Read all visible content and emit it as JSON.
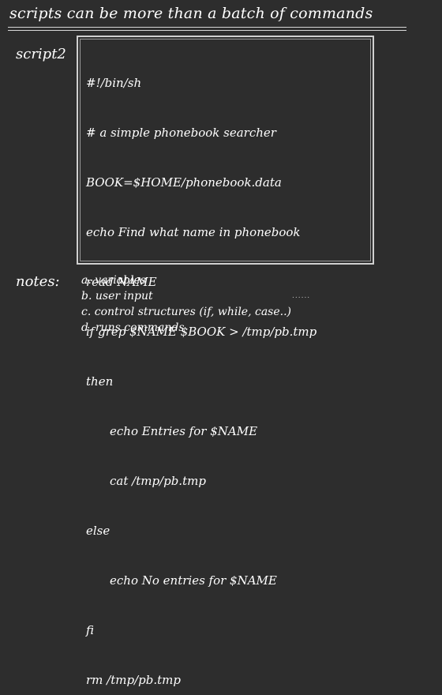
{
  "title": "scripts can be more than a batch of commands",
  "script_label": "script2",
  "code_lines": [
    {
      "text": "#!/bin/sh"
    },
    {
      "text": "# a simple phonebook searcher"
    },
    {
      "text": "BOOK=$HOME/phonebook.data"
    },
    {
      "text": "echo Find what name in phonebook"
    },
    {
      "text": "read NAME"
    },
    {
      "text": "if grep $NAME $BOOK > /tmp/pb.tmp"
    },
    {
      "text": "then"
    },
    {
      "text": "echo Entries for $NAME"
    },
    {
      "text": "cat /tmp/pb.tmp"
    },
    {
      "text": "else"
    },
    {
      "text": "echo No entries for $NAME"
    },
    {
      "text": "fi"
    },
    {
      "text": "rm /tmp/pb.tmp"
    }
  ],
  "notes_label": "notes:",
  "notes": [
    "a. variables",
    "b. user input",
    "c. control structures (if, while, case..)",
    "d. runs commands"
  ],
  "dots": "......"
}
